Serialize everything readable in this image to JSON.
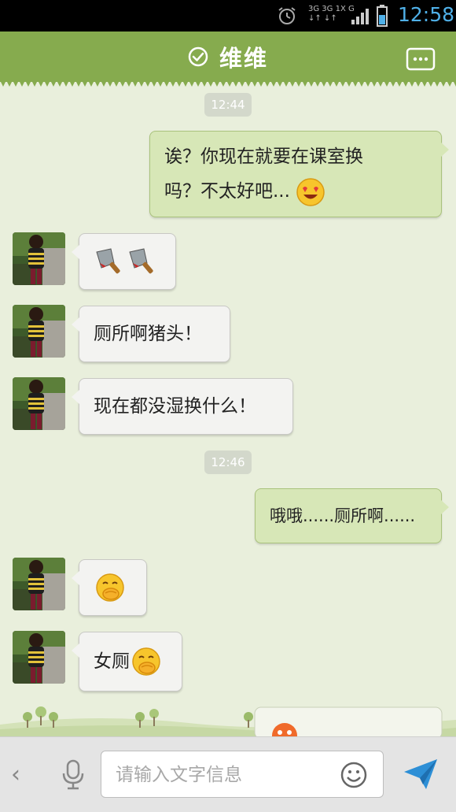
{
  "status_bar": {
    "time": "12:58",
    "network_top": "3G 3G 1X G",
    "network_bottom": "↓↑ ↓↑"
  },
  "header": {
    "title": "维维"
  },
  "messages": [
    {
      "type": "timestamp",
      "text": "12:44"
    },
    {
      "type": "out",
      "text": "诶？你现在就要在课室换",
      "text2": "吗？不太好吧...",
      "emoji": "heart-eyes-emoji"
    },
    {
      "type": "in",
      "text": "",
      "emoji": "cleaver-emoji"
    },
    {
      "type": "in",
      "text": "厕所啊猪头！"
    },
    {
      "type": "in",
      "text": "现在都没湿换什么！"
    },
    {
      "type": "timestamp",
      "text": "12:46"
    },
    {
      "type": "out",
      "text": "哦哦......厕所啊......"
    },
    {
      "type": "in",
      "text": "",
      "emoji": "shy-giggle-emoji"
    },
    {
      "type": "in",
      "text": "女厕",
      "emoji": "shy-giggle-emoji"
    }
  ],
  "input": {
    "placeholder": "请输入文字信息",
    "value": ""
  },
  "colors": {
    "header": "#86ab4e",
    "background": "#e9efdc",
    "out_bubble": "#d7e7b7",
    "in_bubble": "#f3f3f1",
    "time_accent": "#4fb0e8",
    "send_icon": "#2d8fd6"
  }
}
